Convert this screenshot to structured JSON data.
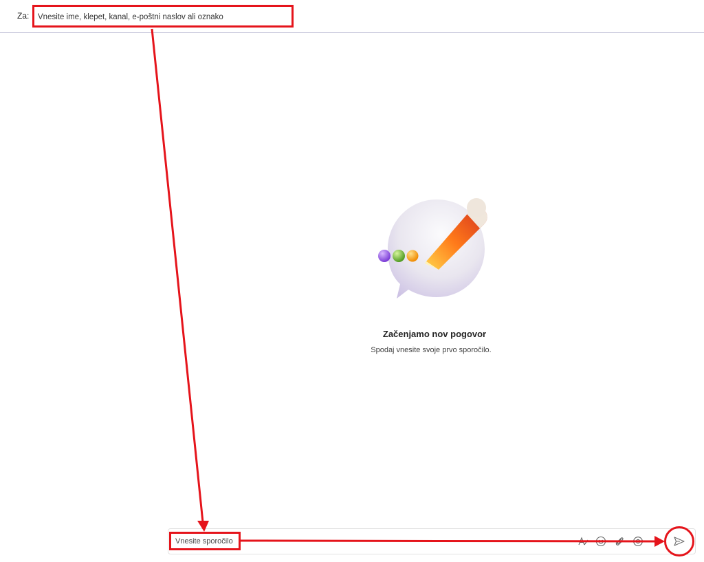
{
  "header": {
    "to_label": "Za:",
    "to_placeholder": "Vnesite ime, klepet, kanal, e-poštni naslov ali oznako"
  },
  "empty_state": {
    "title": "Začenjamo nov pogovor",
    "subtitle": "Spodaj vnesite svoje prvo sporočilo.",
    "illustration": "new-chat-illustration"
  },
  "composer": {
    "placeholder": "Vnesite sporočilo",
    "tools": [
      "format-icon",
      "emoji-icon",
      "attach-icon",
      "loop-icon",
      "more-icon"
    ],
    "send": "send-icon"
  },
  "annotation": {
    "color": "#e5141b"
  }
}
